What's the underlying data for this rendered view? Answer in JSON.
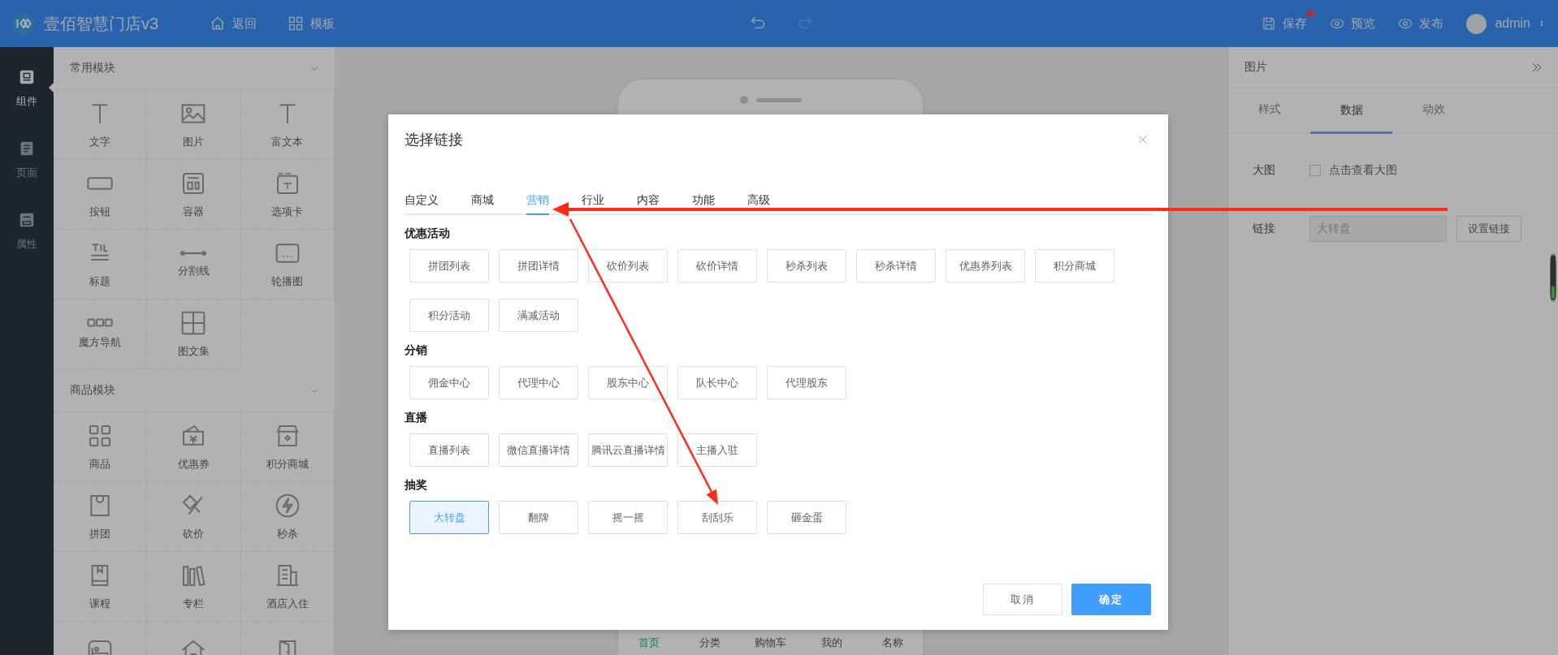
{
  "top_bar": {
    "app_title": "壹佰智慧门店v3",
    "nav_links": [
      {
        "label": "返回"
      },
      {
        "label": "模板"
      }
    ],
    "actions": [
      {
        "label": "保存",
        "badge": true
      },
      {
        "label": "预览",
        "badge": false
      },
      {
        "label": "发布",
        "badge": false
      }
    ],
    "user": {
      "name": "admin"
    }
  },
  "left_nav": [
    {
      "label": "组件",
      "selected": true
    },
    {
      "label": "页面",
      "selected": false
    },
    {
      "label": "属性",
      "selected": false
    }
  ],
  "component_panel": {
    "sections": [
      {
        "title": "常用模块",
        "expanded": true,
        "items": [
          {
            "label": "文字",
            "cut": false
          },
          {
            "label": "图片",
            "cut": false
          },
          {
            "label": "富文本",
            "cut": false
          },
          {
            "label": "按钮",
            "cut": false
          },
          {
            "label": "容器",
            "cut": false
          },
          {
            "label": "选项卡",
            "cut": false
          },
          {
            "label": "标题",
            "cut": false
          },
          {
            "label": "分割线",
            "cut": false
          },
          {
            "label": "轮播图",
            "cut": false
          },
          {
            "label": "魔方导航",
            "cut": false
          },
          {
            "label": "图文集",
            "cut": false
          }
        ]
      },
      {
        "title": "商品模块",
        "expanded": true,
        "items": [
          {
            "label": "商品",
            "cut": false
          },
          {
            "label": "优惠券",
            "cut": false
          },
          {
            "label": "积分商城",
            "cut": false
          },
          {
            "label": "拼团",
            "cut": false
          },
          {
            "label": "砍价",
            "cut": false
          },
          {
            "label": "秒杀",
            "cut": false
          },
          {
            "label": "课程",
            "cut": false
          },
          {
            "label": "专栏",
            "cut": false
          },
          {
            "label": "酒店入住",
            "cut": false
          },
          {
            "cut": true
          },
          {
            "cut": true
          },
          {
            "cut": true
          }
        ]
      }
    ]
  },
  "phone": {
    "tabs": [
      {
        "label": "首页",
        "selected": true
      },
      {
        "label": "分类",
        "selected": false
      },
      {
        "label": "购物车",
        "selected": false
      },
      {
        "label": "我的",
        "selected": false
      },
      {
        "label": "名称",
        "selected": false
      }
    ]
  },
  "right_panel": {
    "title": "图片",
    "tabs": [
      {
        "label": "样式",
        "selected": false
      },
      {
        "label": "数据",
        "selected": true
      },
      {
        "label": "动效",
        "selected": false
      }
    ],
    "big_image": {
      "label": "大图",
      "checked": false,
      "text": "点击查看大图"
    },
    "link": {
      "label": "链接",
      "value": "大转盘",
      "button": "设置链接"
    }
  },
  "modal": {
    "title": "选择链接",
    "tabs": [
      {
        "label": "自定义",
        "selected": false
      },
      {
        "label": "商城",
        "selected": false
      },
      {
        "label": "营销",
        "selected": true
      },
      {
        "label": "行业",
        "selected": false
      },
      {
        "label": "内容",
        "selected": false
      },
      {
        "label": "功能",
        "selected": false
      },
      {
        "label": "高级",
        "selected": false
      }
    ],
    "groups": [
      {
        "title": "优惠活动",
        "options": [
          {
            "label": "拼团列表",
            "selected": false
          },
          {
            "label": "拼团详情",
            "selected": false
          },
          {
            "label": "砍价列表",
            "selected": false
          },
          {
            "label": "砍价详情",
            "selected": false
          },
          {
            "label": "秒杀列表",
            "selected": false
          },
          {
            "label": "秒杀详情",
            "selected": false
          },
          {
            "label": "优惠券列表",
            "selected": false
          },
          {
            "label": "积分商城",
            "selected": false
          },
          {
            "label": "积分活动",
            "selected": false
          },
          {
            "label": "满减活动",
            "selected": false
          }
        ]
      },
      {
        "title": "分销",
        "options": [
          {
            "label": "佣金中心",
            "selected": false
          },
          {
            "label": "代理中心",
            "selected": false
          },
          {
            "label": "股东中心",
            "selected": false
          },
          {
            "label": "队长中心",
            "selected": false
          },
          {
            "label": "代理股东",
            "selected": false
          }
        ]
      },
      {
        "title": "直播",
        "options": [
          {
            "label": "直播列表",
            "selected": false
          },
          {
            "label": "微信直播详情",
            "selected": false
          },
          {
            "label": "腾讯云直播详情",
            "selected": false
          },
          {
            "label": "主播入驻",
            "selected": false
          }
        ]
      },
      {
        "title": "抽奖",
        "options": [
          {
            "label": "大转盘",
            "selected": true
          },
          {
            "label": "翻牌",
            "selected": false
          },
          {
            "label": "摇一摇",
            "selected": false
          },
          {
            "label": "刮刮乐",
            "selected": false
          },
          {
            "label": "砸金蛋",
            "selected": false
          }
        ]
      }
    ],
    "buttons": [
      {
        "label": "取消",
        "kind": "default"
      },
      {
        "label": "确定",
        "kind": "primary"
      }
    ]
  }
}
